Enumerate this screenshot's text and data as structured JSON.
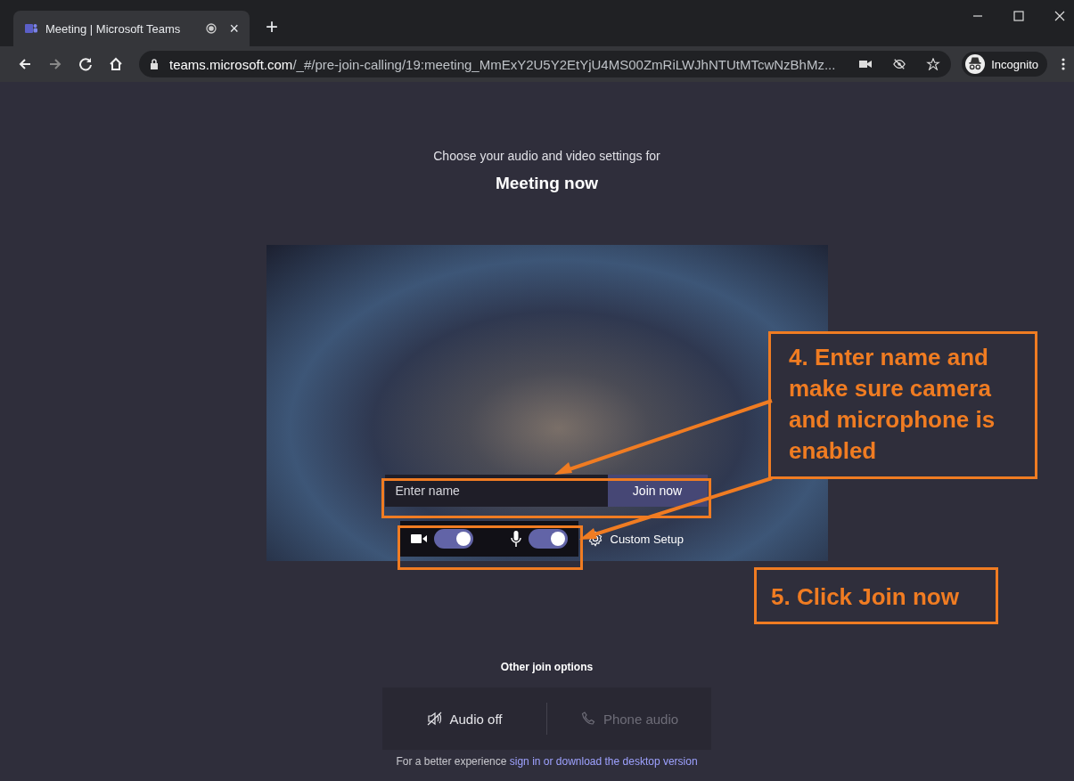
{
  "browser": {
    "tab": {
      "title": "Meeting | Microsoft Teams",
      "close": "×"
    },
    "new_tab": "+",
    "url": {
      "host": "teams.microsoft.com",
      "path": "/_#/pre-join-calling/19:meeting_MmExY2U5Y2EtYjU4MS00ZmRiLWJhNTUtMTcwNzBhMz..."
    },
    "profile": "Incognito"
  },
  "prejoin": {
    "subtitle": "Choose your audio and video settings for",
    "title": "Meeting now",
    "name_field": {
      "placeholder": "Enter name"
    },
    "join_button": "Join now",
    "toggles": [
      {
        "kind": "camera",
        "on": true
      },
      {
        "kind": "microphone",
        "on": true
      }
    ],
    "custom_setup": "Custom Setup",
    "other_heading": "Other join options",
    "options": [
      {
        "kind": "audio-off",
        "label": "Audio off",
        "disabled": false
      },
      {
        "kind": "phone",
        "label": "Phone audio",
        "disabled": true
      }
    ],
    "footer": {
      "text": "For a better experience",
      "link_1": "sign in",
      "middle": "or",
      "link_2": "download the desktop version"
    }
  },
  "annotations": [
    {
      "text": "4. Enter name and make sure camera and microphone is enabled"
    },
    {
      "text": "5. Click Join now"
    }
  ]
}
